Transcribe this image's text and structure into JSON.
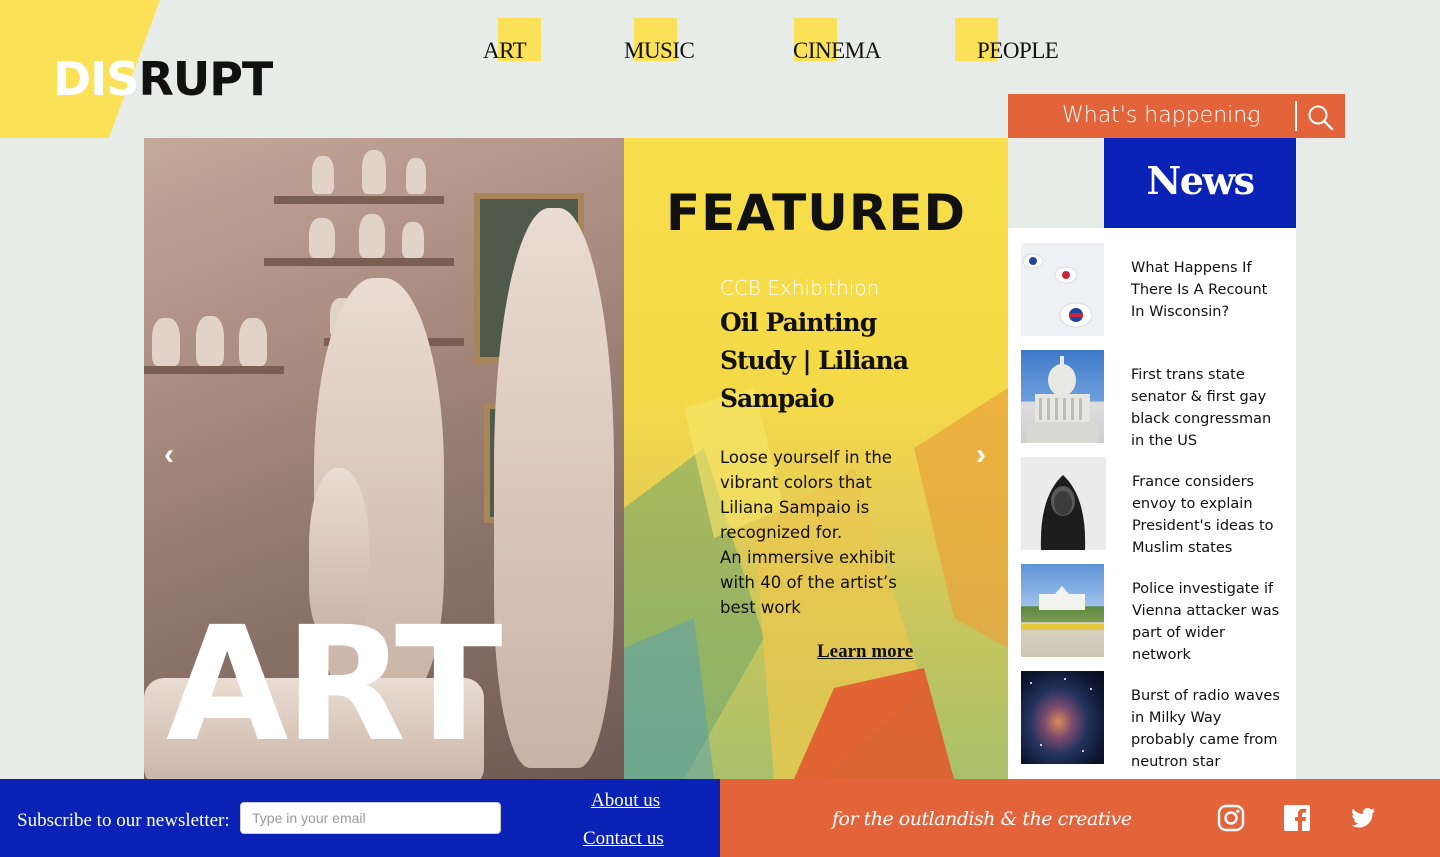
{
  "logo": {
    "part1": "DIS",
    "part2": "RUPT"
  },
  "nav": [
    {
      "label": "ART"
    },
    {
      "label": "MUSIC"
    },
    {
      "label": "CINEMA"
    },
    {
      "label": "PEOPLE"
    }
  ],
  "happening": {
    "label": "What's happening",
    "chevron": "⌄"
  },
  "hero": {
    "title": "ART",
    "prev": "‹",
    "next": "›"
  },
  "featured": {
    "heading": "FEATURED",
    "subtitle": "CCB Exhibithion",
    "title": "Oil Painting Study | Liliana Sampaio",
    "body1": "Loose yourself in the vibrant colors that Liliana Sampaio is recognized for.",
    "body2": "An immersive exhibit with 40 of the artist’s best work",
    "cta": "Learn more"
  },
  "news": {
    "heading": "News",
    "items": [
      {
        "text": "What Happens If There Is A Recount In Wisconsin?"
      },
      {
        "text": "First trans state senator & first gay black congressman in the US"
      },
      {
        "text": "France considers envoy to explain President's ideas to Muslim states"
      },
      {
        "text": "Police investigate if Vienna attacker was part of wider network"
      },
      {
        "text": "Burst of radio waves in Milky Way probably came from neutron star"
      }
    ]
  },
  "footer": {
    "subscribe": "Subscribe to our newsletter:",
    "email_placeholder": "Type in your email",
    "about": "About us",
    "contact": "Contact us",
    "tagline": "for the outlandish & the creative",
    "social": [
      "instagram-icon",
      "facebook-icon",
      "twitter-icon"
    ]
  },
  "colors": {
    "yellow": "#fbe158",
    "orange": "#e3643a",
    "blue": "#0b22b6",
    "background": "#e8ece8"
  }
}
